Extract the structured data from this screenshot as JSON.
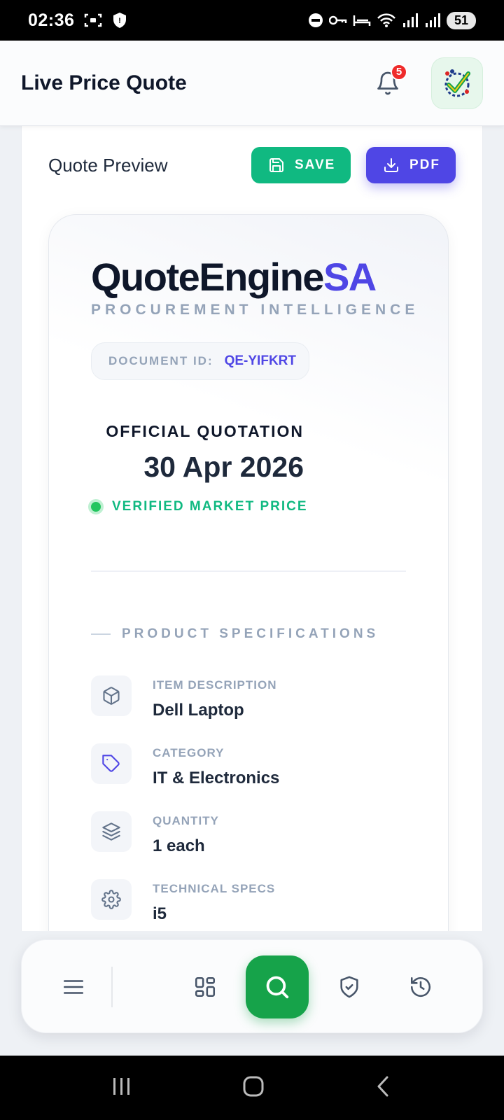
{
  "status_bar": {
    "time": "02:36",
    "battery": "51"
  },
  "header": {
    "title": "Live Price Quote",
    "notification_count": "5"
  },
  "preview": {
    "title": "Quote Preview",
    "save_label": "SAVE",
    "pdf_label": "PDF"
  },
  "quote": {
    "brand_main": "QuoteEngine",
    "brand_accent": "SA",
    "brand_subtitle": "PROCUREMENT INTELLIGENCE",
    "document_id_label": "DOCUMENT ID:",
    "document_id_value": "QE-YIFKRT",
    "official_label": "OFFICIAL QUOTATION",
    "date": "30 Apr 2026",
    "verified_label": "VERIFIED MARKET PRICE",
    "section_title": "PRODUCT SPECIFICATIONS",
    "specs": [
      {
        "icon": "box-icon",
        "label": "ITEM DESCRIPTION",
        "value": "Dell Laptop"
      },
      {
        "icon": "tag-icon",
        "label": "CATEGORY",
        "value": "IT & Electronics"
      },
      {
        "icon": "layers-icon",
        "label": "QUANTITY",
        "value": "1 each"
      },
      {
        "icon": "gear-icon",
        "label": "TECHNICAL SPECS",
        "value": "i5"
      }
    ]
  },
  "colors": {
    "accent": "#4f46e5",
    "save": "#10b981",
    "search": "#16a34a",
    "badge": "#ef2b2b"
  }
}
